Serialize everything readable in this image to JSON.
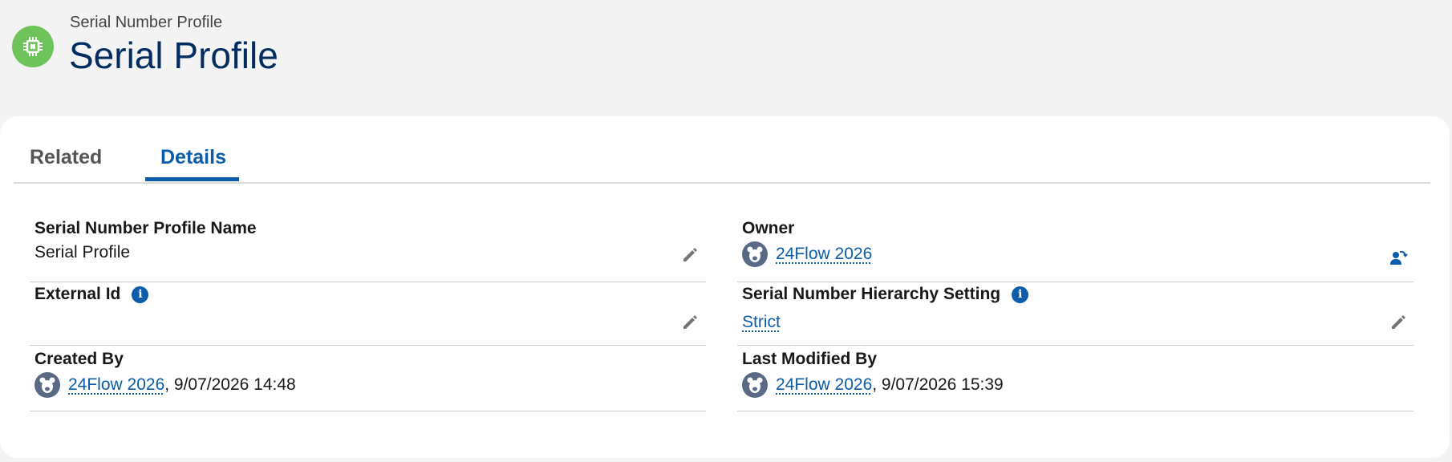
{
  "header": {
    "object_type": "Serial Number Profile",
    "record_title": "Serial Profile",
    "icon": "chip-icon",
    "icon_color": "#6fc35b"
  },
  "tabs": [
    {
      "label": "Related",
      "active": false
    },
    {
      "label": "Details",
      "active": true
    }
  ],
  "fields": {
    "name": {
      "label": "Serial Number Profile Name",
      "value": "Serial Profile"
    },
    "owner": {
      "label": "Owner",
      "value": "24Flow 2026"
    },
    "external_id": {
      "label": "External Id",
      "value": ""
    },
    "hierarchy": {
      "label": "Serial Number Hierarchy Setting",
      "value": "Strict"
    },
    "created_by": {
      "label": "Created By",
      "user": "24Flow 2026",
      "date": ", 9/07/2026 14:48"
    },
    "modified_by": {
      "label": "Last Modified By",
      "user": "24Flow 2026",
      "date": ", 9/07/2026 15:39"
    }
  },
  "colors": {
    "accent": "#0b5cab",
    "title": "#032d60"
  }
}
